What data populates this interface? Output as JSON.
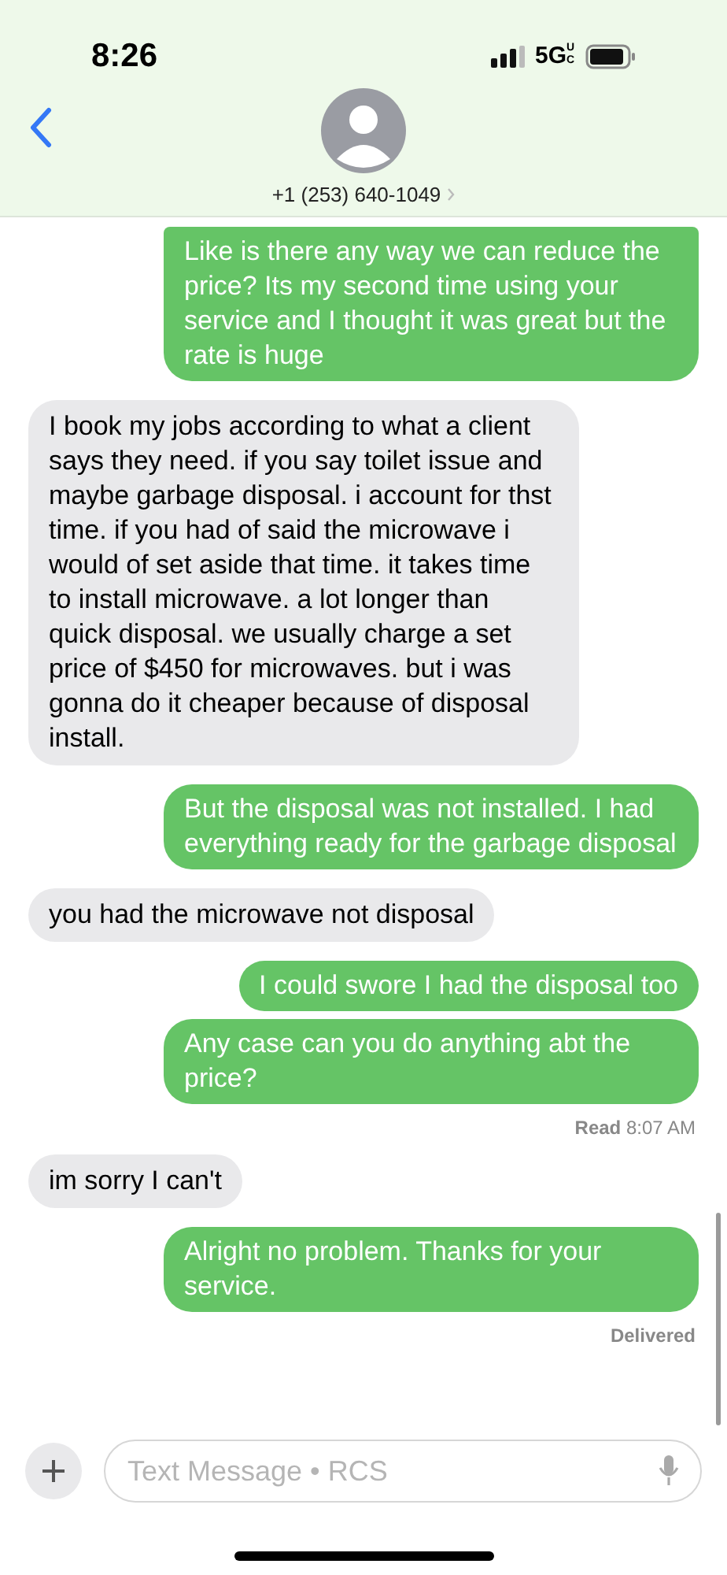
{
  "status_bar": {
    "time": "8:26",
    "network": "5G",
    "network_suffix": "UC"
  },
  "header": {
    "contact": "+1 (253) 640-1049"
  },
  "messages": [
    {
      "kind": "sent",
      "text": "Like is there any way we can reduce the price? Its my second time using your service and I thought it was great but the rate is huge"
    },
    {
      "kind": "received",
      "text": "I book my jobs according to what a client says they need. if you say toilet issue and maybe garbage disposal. i account for thst time. if you had of said the microwave i would of set aside that time. it takes time to install microwave.  a lot longer than quick disposal.  we usually charge a set price of $450 for microwaves. but i was gonna do it cheaper because of disposal install."
    },
    {
      "kind": "sent",
      "text": "But the disposal was not installed. I had everything ready for the garbage disposal"
    },
    {
      "kind": "received",
      "text": "you had the microwave not disposal"
    },
    {
      "kind": "sent",
      "text": "I could swore I had the disposal too"
    },
    {
      "kind": "sent",
      "text": "Any case can you do anything abt the price?"
    },
    {
      "kind": "receipt",
      "text": "**Read** 8:07 AM"
    },
    {
      "kind": "received",
      "text": "im sorry I can't"
    },
    {
      "kind": "sent",
      "text": "Alright no problem. Thanks for your service."
    },
    {
      "kind": "receipt",
      "text": "**Delivered**"
    }
  ],
  "composer": {
    "placeholder": "Text Message • RCS"
  }
}
